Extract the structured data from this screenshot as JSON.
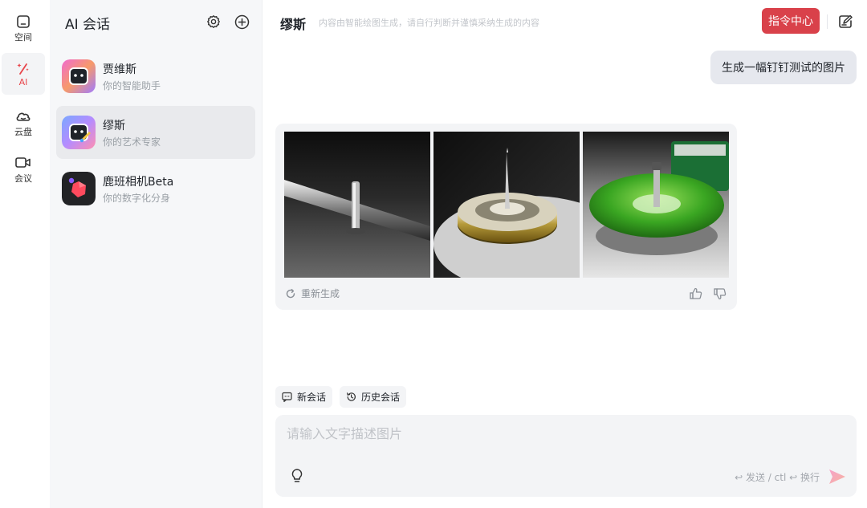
{
  "rail": {
    "items": [
      {
        "label": "空间",
        "icon": "space-icon"
      },
      {
        "label": "AI",
        "icon": "ai-wand-icon"
      },
      {
        "label": "云盘",
        "icon": "cloud-icon"
      },
      {
        "label": "会议",
        "icon": "video-icon"
      }
    ]
  },
  "panel": {
    "title": "AI 会话",
    "conversations": [
      {
        "name": "贾维斯",
        "subtitle": "你的智能助手"
      },
      {
        "name": "缪斯",
        "subtitle": "你的艺术专家"
      },
      {
        "name": "鹿班相机Beta",
        "subtitle": "你的数字化分身"
      }
    ]
  },
  "main": {
    "title": "缪斯",
    "hint": "内容由智能绘图生成，请自行判断并谨慎采纳生成的内容",
    "command_center": "指令中心",
    "user_message": "生成一幅钉钉测试的图片",
    "regenerate": "重新生成",
    "chips": {
      "new_chat": "新会话",
      "history": "历史会话"
    },
    "composer": {
      "placeholder": "请输入文字描述图片",
      "send_hint": "↩ 发送 / ctl ↩ 换行"
    }
  },
  "colors": {
    "accent": "#d9414a",
    "active_rail": "#e8454b"
  }
}
